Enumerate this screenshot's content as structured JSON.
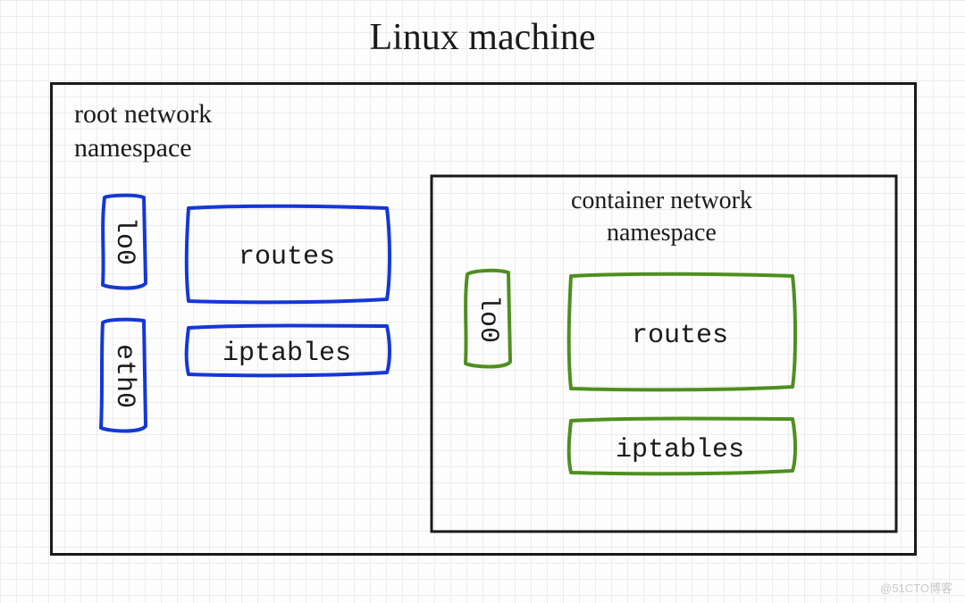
{
  "title": "Linux machine",
  "root_namespace": {
    "label_line1": "root network",
    "label_line2": "namespace",
    "lo0": "lo0",
    "eth0": "eth0",
    "routes": "routes",
    "iptables": "iptables"
  },
  "container_namespace": {
    "label_line1": "container network",
    "label_line2": "namespace",
    "lo0": "lo0",
    "routes": "routes",
    "iptables": "iptables"
  },
  "watermark": "@51CTO博客",
  "colors": {
    "blue": "#1438d4",
    "green": "#4e8f1f",
    "black": "#1a1a1a"
  }
}
